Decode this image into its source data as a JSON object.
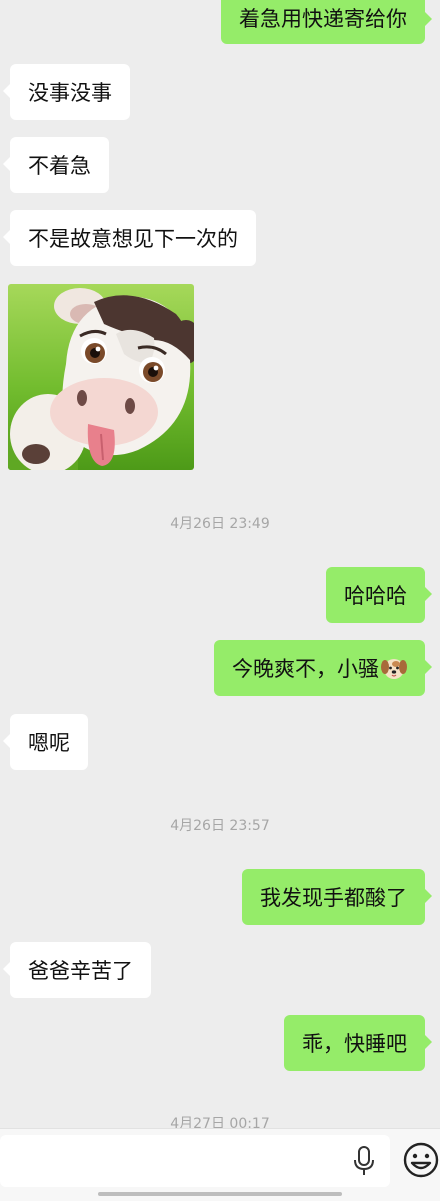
{
  "messages": [
    {
      "direction": "out",
      "text": "着急用快递寄给你"
    },
    {
      "direction": "in",
      "text": "没事没事"
    },
    {
      "direction": "in",
      "text": "不着急"
    },
    {
      "direction": "in",
      "text": "不是故意想见下一次的"
    },
    {
      "direction": "in",
      "type": "sticker",
      "icon": "cartoon-cow-sticker"
    },
    {
      "type": "timestamp",
      "text": "4月26日 23:49"
    },
    {
      "direction": "out",
      "text": "哈哈哈"
    },
    {
      "direction": "out",
      "text": "今晚爽不，小骚",
      "icon": "dog-face-emoji"
    },
    {
      "direction": "in",
      "text": "嗯呢"
    },
    {
      "type": "timestamp",
      "text": "4月26日 23:57"
    },
    {
      "direction": "out",
      "text": "我发现手都酸了"
    },
    {
      "direction": "in",
      "text": "爸爸辛苦了"
    },
    {
      "direction": "out",
      "text": "乖，快睡吧"
    },
    {
      "type": "timestamp",
      "text": "4月27日 00:17",
      "partially_hidden": true
    }
  ],
  "input_bar": {
    "value": "",
    "voice_icon": "microphone-icon",
    "emoji_icon": "smiley-face-icon"
  },
  "colors": {
    "background": "#ededed",
    "outgoing_bubble": "#95ec69",
    "incoming_bubble": "#ffffff",
    "timestamp_text": "#a6a6a6"
  }
}
